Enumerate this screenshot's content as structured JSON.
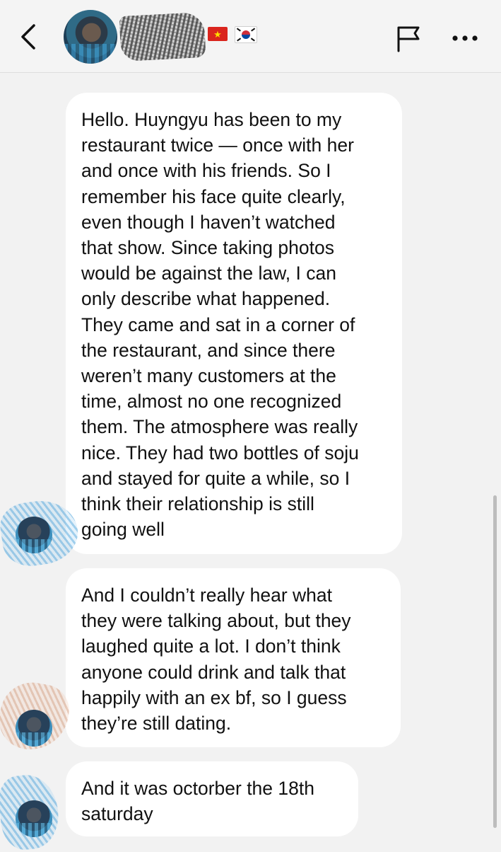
{
  "header": {
    "flag_vn": "★",
    "icons": {
      "back": "chevron-left-icon",
      "report": "flag-icon",
      "more": "more-horizontal-icon"
    }
  },
  "messages": [
    {
      "text": "Hello. Huyngyu has been to my\nrestaurant twice — once with her\nand once with his friends. So I\nremember his face quite clearly,\neven though I haven’t watched\nthat show. Since taking photos\nwould be against the law, I can\nonly describe what happened.\nThey came and sat in a corner of\nthe restaurant, and since there\nweren’t many customers at the\ntime, almost no one recognized\nthem. The atmosphere was really\nnice. They had two bottles of soju\nand stayed for quite a while, so I\nthink their relationship is still\ngoing well"
    },
    {
      "text": "And I couldn’t really hear what\nthey were talking about, but they\nlaughed quite a lot. I don’t think\nanyone could drink and talk that\nhappily with an ex bf, so I guess\nthey’re still dating."
    },
    {
      "text": "And it was octorber the 18th\nsaturday"
    }
  ],
  "colors": {
    "background": "#f2f2f2",
    "bubble": "#ffffff",
    "text": "#111111"
  }
}
